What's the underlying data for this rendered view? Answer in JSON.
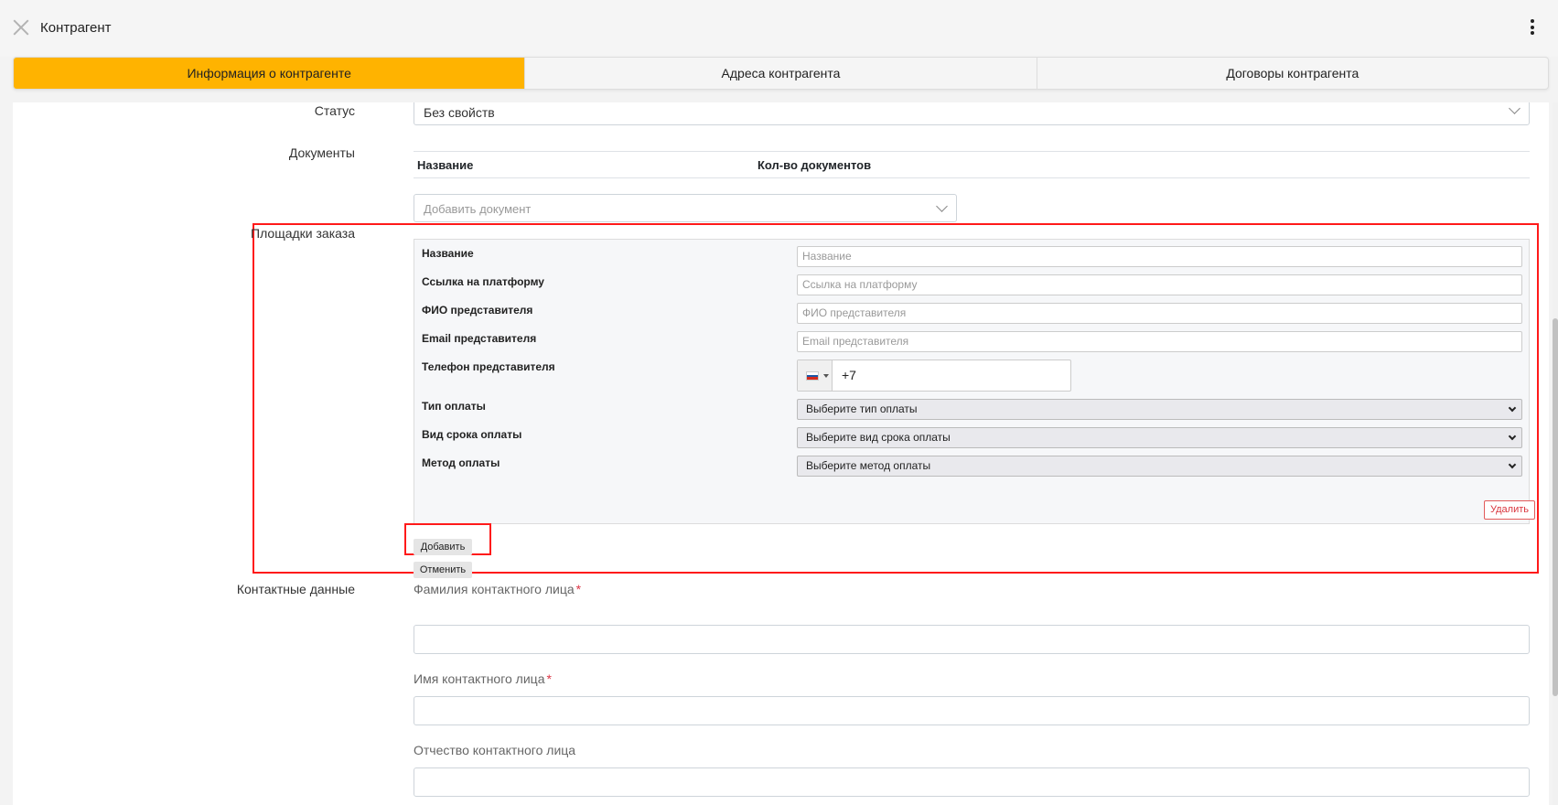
{
  "header": {
    "title": "Контрагент"
  },
  "tabs": [
    {
      "label": "Информация о контрагенте",
      "active": true
    },
    {
      "label": "Адреса контрагента",
      "active": false
    },
    {
      "label": "Договоры контрагента",
      "active": false
    }
  ],
  "status": {
    "label": "Статус",
    "value": "Без свойств"
  },
  "documents": {
    "label": "Документы",
    "col_name": "Название",
    "col_count": "Кол-во документов",
    "add_placeholder": "Добавить документ"
  },
  "platforms": {
    "label": "Площадки заказа",
    "fields": {
      "name_label": "Название",
      "name_placeholder": "Название",
      "link_label": "Ссылка на платформу",
      "link_placeholder": "Ссылка на платформу",
      "rep_name_label": "ФИО представителя",
      "rep_name_placeholder": "ФИО представителя",
      "rep_email_label": "Email представителя",
      "rep_email_placeholder": "Email представителя",
      "rep_phone_label": "Телефон представителя",
      "rep_phone_value": "+7",
      "payment_type_label": "Тип оплаты",
      "payment_type_value": "Выберите тип оплаты",
      "payment_term_label": "Вид срока оплаты",
      "payment_term_value": "Выберите вид срока оплаты",
      "payment_method_label": "Метод оплаты",
      "payment_method_value": "Выберите метод оплаты"
    },
    "delete_label": "Удалить",
    "add_label": "Добавить",
    "cancel_label": "Отменить"
  },
  "contacts": {
    "label": "Контактные данные",
    "last_name_label": "Фамилия контактного лица",
    "first_name_label": "Имя контактного лица",
    "middle_name_label": "Отчество контактного лица",
    "required_mark": "*"
  },
  "colors": {
    "accent": "#ffb300",
    "highlight": "#ff1a1a",
    "danger": "#d9363e"
  }
}
